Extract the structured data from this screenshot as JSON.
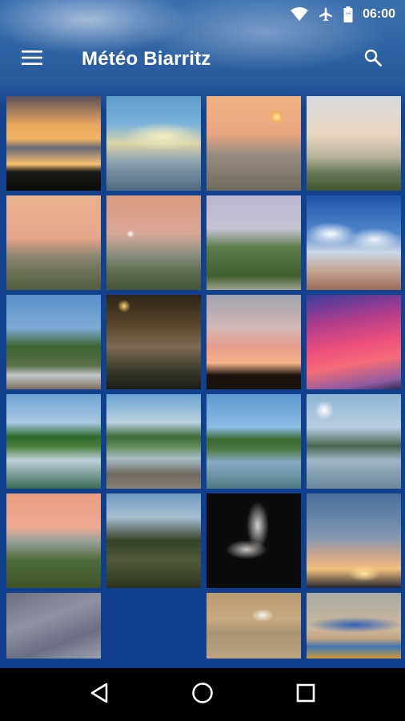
{
  "status_bar": {
    "time": "06:00",
    "icons": [
      "wifi-icon",
      "airplane-mode-icon",
      "battery-icon"
    ]
  },
  "app_bar": {
    "title": "Météo Biarritz",
    "menu_icon": "menu-icon",
    "search_icon": "search-icon"
  },
  "gallery": {
    "photos": [
      {
        "subject": "sunset-clouds"
      },
      {
        "subject": "cloudy-sky-lake"
      },
      {
        "subject": "foggy-sunrise"
      },
      {
        "subject": "misty-river-sunrise"
      },
      {
        "subject": "pink-foggy-field"
      },
      {
        "subject": "pink-foggy-field-sun"
      },
      {
        "subject": "misty-trees"
      },
      {
        "subject": "clouds-over-town"
      },
      {
        "subject": "balcony-view"
      },
      {
        "subject": "night-street"
      },
      {
        "subject": "pink-sunset-trees"
      },
      {
        "subject": "magenta-sky"
      },
      {
        "subject": "lake-reflection"
      },
      {
        "subject": "lake-red-boat"
      },
      {
        "subject": "lake-trees-reflection"
      },
      {
        "subject": "river-sun"
      },
      {
        "subject": "sunset-hills"
      },
      {
        "subject": "fallen-tree"
      },
      {
        "subject": "night-statue"
      },
      {
        "subject": "sunset-rays"
      },
      {
        "subject": "grey-sky"
      },
      {
        "subject": "heron-on-beach"
      },
      {
        "subject": "blue-boats"
      }
    ]
  },
  "nav_bar": {
    "back_icon": "back-icon",
    "home_icon": "home-icon",
    "recents_icon": "recents-icon"
  },
  "colors": {
    "primary_blue": "#0f3f8d",
    "nav_black": "#000000",
    "text_white": "#ffffff"
  }
}
